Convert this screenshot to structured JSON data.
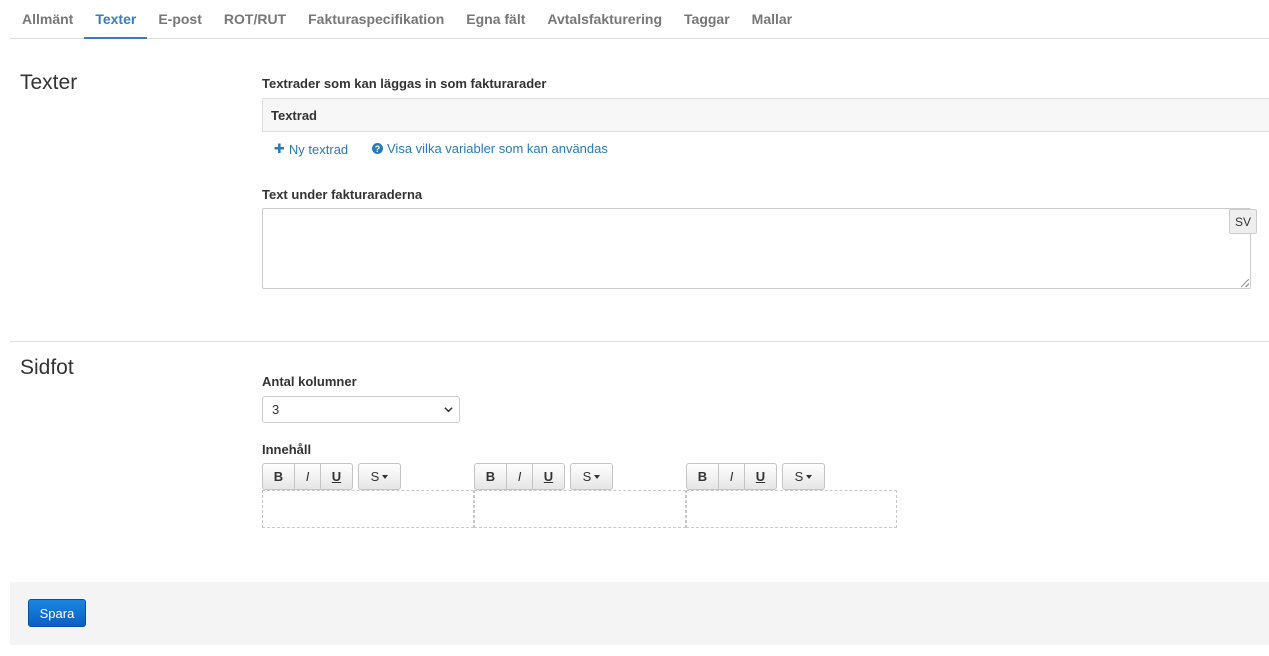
{
  "tabs": [
    {
      "label": "Allmänt",
      "active": false
    },
    {
      "label": "Texter",
      "active": true
    },
    {
      "label": "E-post",
      "active": false
    },
    {
      "label": "ROT/RUT",
      "active": false
    },
    {
      "label": "Fakturaspecifikation",
      "active": false
    },
    {
      "label": "Egna fält",
      "active": false
    },
    {
      "label": "Avtalsfakturering",
      "active": false
    },
    {
      "label": "Taggar",
      "active": false
    },
    {
      "label": "Mallar",
      "active": false
    }
  ],
  "texter": {
    "title": "Texter",
    "textrader_label": "Textrader som kan läggas in som fakturarader",
    "textrad_header": "Textrad",
    "new_textrad_link": "Ny textrad",
    "variables_link": "Visa vilka variabler som kan användas",
    "text_under_label": "Text under fakturaraderna",
    "text_under_value": "",
    "language_button": "SV"
  },
  "sidfot": {
    "title": "Sidfot",
    "columns_label": "Antal kolumner",
    "columns_value": "3",
    "content_label": "Innehåll",
    "toolbar": {
      "bold": "B",
      "italic": "I",
      "underline": "U",
      "size": "S"
    }
  },
  "footer": {
    "save_label": "Spara"
  },
  "colors": {
    "accent": "#3a7bbf",
    "link": "#2a7ab8",
    "primary_button": "#0a6fd0"
  }
}
